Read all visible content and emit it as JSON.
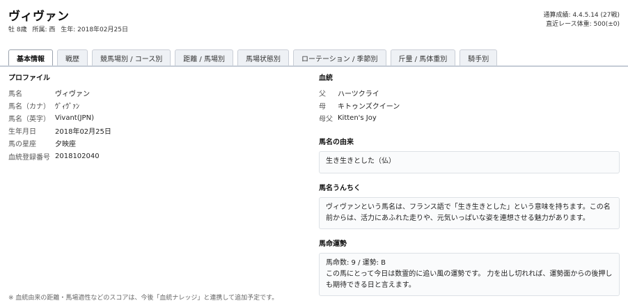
{
  "header": {
    "name": "ヴィヴァン",
    "sex_age": "牡 8歳",
    "stable": "所属: 西",
    "birth": "生年: 2018年02月25日",
    "record": "通算成績: 4.4.5.14 (27戦)",
    "weight": "直近レース体重: 500(±0)"
  },
  "tabs": [
    {
      "label": "基本情報",
      "active": true
    },
    {
      "label": "戦歴"
    },
    {
      "label": "競馬場別 / コース別"
    },
    {
      "label": "距離 / 馬場別"
    },
    {
      "label": "馬場状態別"
    },
    {
      "label": "ローテーション / 季節別"
    },
    {
      "label": "斤量 / 馬体重別"
    },
    {
      "label": "騎手別"
    }
  ],
  "profile": {
    "title": "プロファイル",
    "rows": [
      {
        "label": "馬名",
        "value": "ヴィヴァン"
      },
      {
        "label": "馬名（カナ）",
        "value": "ｳﾞｨｳﾞｧﾝ"
      },
      {
        "label": "馬名（英字）",
        "value": "Vivant(JPN)"
      },
      {
        "label": "生年月日",
        "value": "2018年02月25日"
      },
      {
        "label": "馬の星座",
        "value": "夕映座"
      },
      {
        "label": "血統登録番号",
        "value": "2018102040"
      }
    ]
  },
  "pedigree": {
    "title": "血統",
    "rows": [
      {
        "label": "父",
        "value": "ハーツクライ"
      },
      {
        "label": "母",
        "value": "キトゥンズクイーン"
      },
      {
        "label": "母父",
        "value": "Kitten's Joy"
      }
    ]
  },
  "origin": {
    "title": "馬名の由来",
    "text": "生き生きとした（仏）"
  },
  "trivia": {
    "title": "馬名うんちく",
    "text": "ヴィヴァンという馬名は、フランス語で「生き生きとした」という意味を持ちます。この名前からは、活力にあふれた走りや、元気いっぱいな姿を連想させる魅力があります。"
  },
  "fortune": {
    "title": "馬命運勢",
    "line1": "馬命数: 9 / 運勢: B",
    "text": "この馬にとって今日は数霊的に追い風の運勢です。 力を出し切れれば、運勢面からの後押しも期待できる日と言えます。"
  },
  "footnote": "※ 血統由来の距離・馬場適性などのスコアは、今後「血統ナレッジ」と連携して追加予定です。"
}
